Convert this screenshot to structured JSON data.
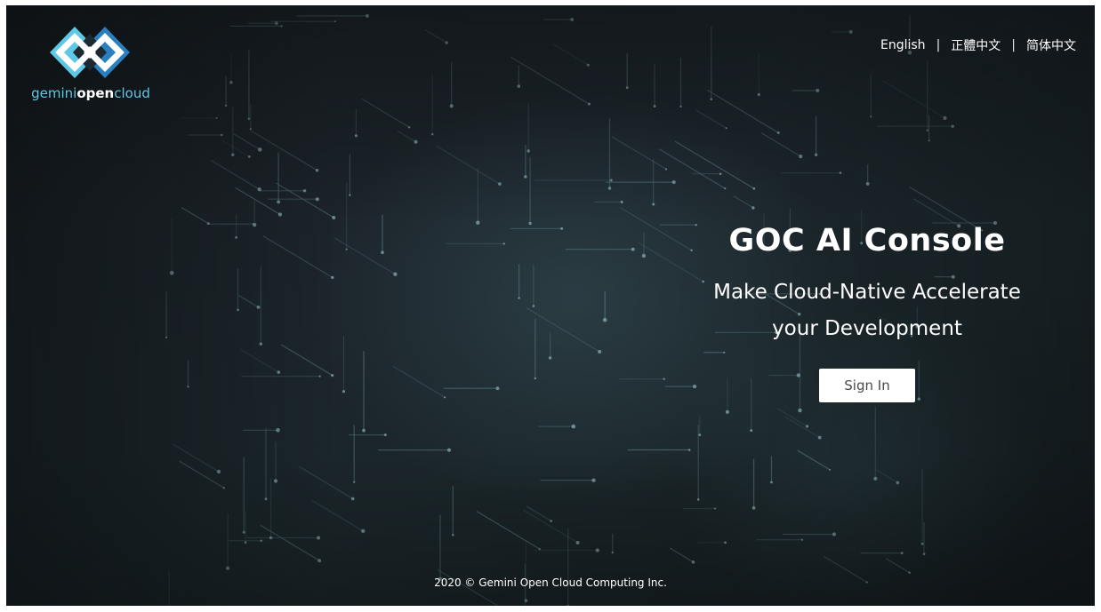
{
  "brand": {
    "logo_icon": "gemini-diamond-logo",
    "name_part1": "gemini",
    "name_part2": "open",
    "name_part3": "cloud",
    "colors": {
      "accent": "#5ec8e6",
      "accent_dark": "#2a7fbf"
    }
  },
  "languages": [
    {
      "label": "English"
    },
    {
      "label": "正體中文"
    },
    {
      "label": "简体中文"
    }
  ],
  "language_separator": "|",
  "hero": {
    "title": "GOC AI Console",
    "subtitle_line1": "Make Cloud-Native Accelerate",
    "subtitle_line2": "your Development",
    "signin_label": "Sign In"
  },
  "footer": {
    "text": "2020 © Gemini Open Cloud Computing Inc."
  }
}
